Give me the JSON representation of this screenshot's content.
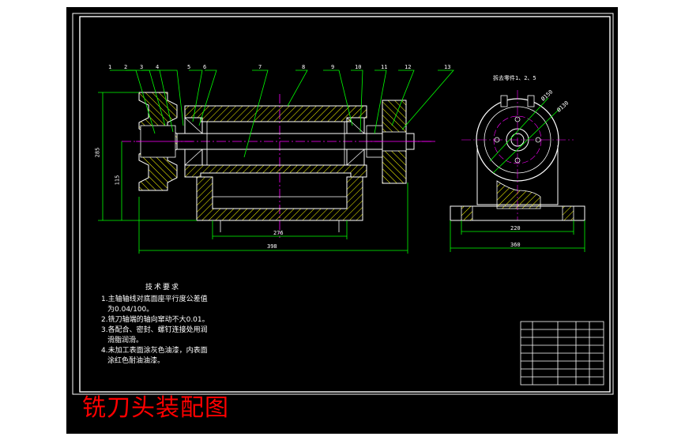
{
  "drawing_title": "铣刀头装配图",
  "technical_requirements": {
    "heading": "技术要求",
    "lines": [
      "1.主轴轴线对底面座平行度公差值",
      "为0.04/100。",
      "2.铣刀轴端的轴向窜动不大0.01。",
      "3.各配合、密封、螺钉连接处用润",
      "滑脂润滑。",
      "4.未加工表面涂灰色油漆，内表面",
      "涂红色耐油油漆。"
    ]
  },
  "balloons": [
    "1",
    "2",
    "3",
    "4",
    "5",
    "6",
    "7",
    "8",
    "9",
    "10",
    "11",
    "12",
    "13"
  ],
  "side_view_note": "拆去零件1、2、5",
  "dimensions": {
    "overall_height": "285",
    "center_height": "115",
    "bore_span": "276",
    "overall_length": "398",
    "base_width_inner": "220",
    "base_width_outer": "360",
    "bolt_circle_1": "Ø150",
    "bolt_circle_2": "Ø130"
  },
  "colors": {
    "background": "#000000",
    "outline": "#ffffff",
    "leader": "#00ff00",
    "centerline": "#ff00ff",
    "hatch": "#ffff00",
    "border": "#ffffff",
    "title_text": "#ff0000"
  }
}
